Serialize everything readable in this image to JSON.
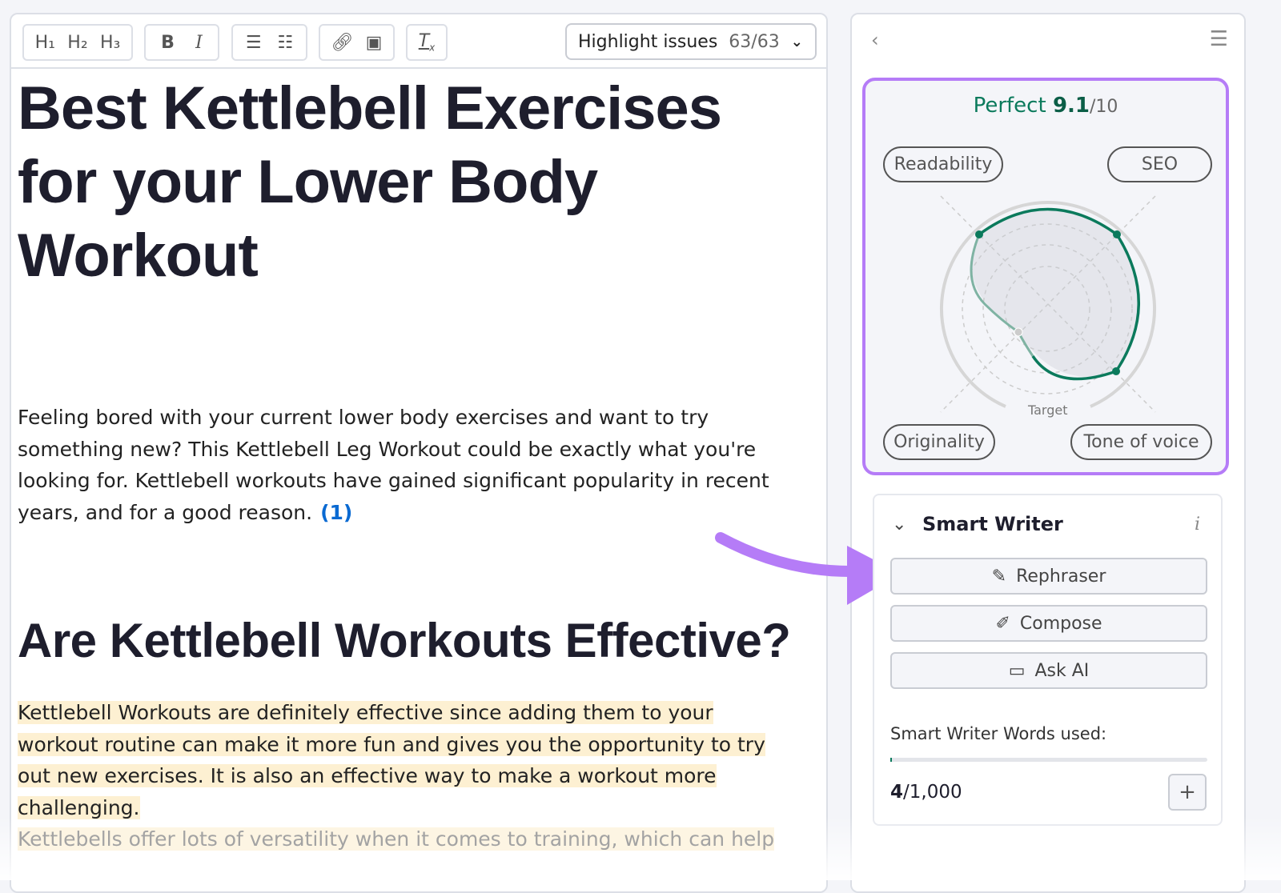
{
  "toolbar": {
    "h1": "H₁",
    "h2": "H₂",
    "h3": "H₃",
    "bold": "B",
    "italic": "I",
    "highlight_label": "Highlight issues",
    "highlight_count": "63/63"
  },
  "article": {
    "title": "Best Kettlebell Exercises for your Lower Body Workout",
    "intro": "Feeling bored with your current lower body exercises and want to try something new? This Kettlebell Leg Workout could be exactly what you're looking for. Kettlebell workouts have gained significant popularity in recent years, and for a good reason.",
    "citation": "(1)",
    "heading2": "Are Kettlebell Workouts Effective?",
    "para2": "Kettlebell Workouts are definitely effective since adding them to your workout routine can make it more fun and gives you the opportunity to try out new exercises. It is also an effective way to make a workout more challenging.",
    "para3": "Kettlebells offer lots of versatility when it comes to training, which can help"
  },
  "score": {
    "label": "Perfect",
    "value": "9.1",
    "max": "/10",
    "target_label": "Target",
    "axes": [
      "Readability",
      "SEO",
      "Originality",
      "Tone of voice"
    ],
    "accent": "#0b7a5c",
    "border": "#b57cf7"
  },
  "smart_writer": {
    "title": "Smart Writer",
    "info": "i",
    "buttons": [
      "Rephraser",
      "Compose",
      "Ask AI"
    ],
    "words_label": "Smart Writer Words used:",
    "words_used": "4",
    "words_total": "/1,000",
    "words_fraction": 0.004,
    "add": "+"
  }
}
